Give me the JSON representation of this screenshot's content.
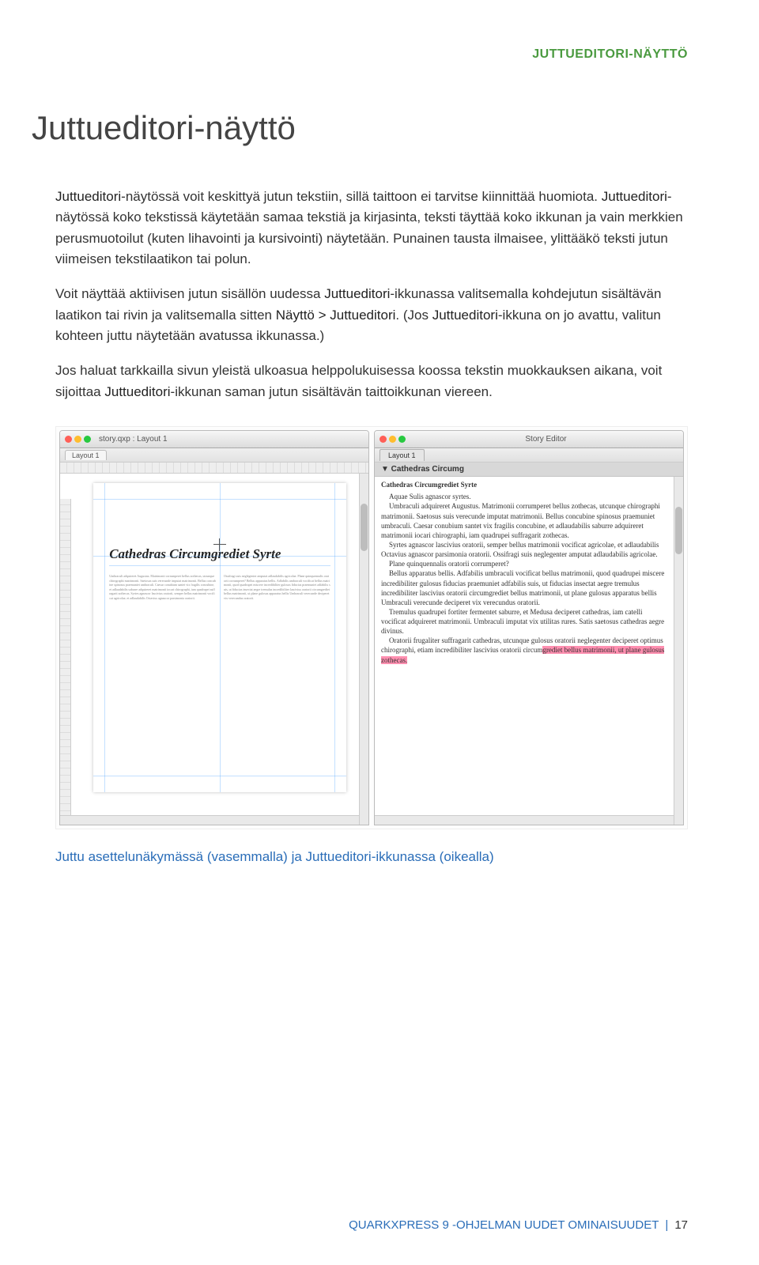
{
  "header": {
    "label": "JUTTUEDITORI-NÄYTTÖ"
  },
  "title": "Juttueditori-näyttö",
  "paragraphs": {
    "p1a": "Juttueditori",
    "p1b": "-näytössä voit keskittyä jutun tekstiin, sillä taittoon ei tarvitse kiinnittää huomiota. ",
    "p1c": "Juttueditori",
    "p1d": "-näytössä koko tekstissä käytetään samaa tekstiä ja kirjasinta, teksti täyttää koko ikkunan ja vain merkkien perusmuotoilut (kuten lihavointi ja kursivointi) näytetään. Punainen tausta ilmaisee, ylittääkö teksti jutun viimeisen tekstilaatikon tai polun.",
    "p2a": "Voit näyttää aktiivisen jutun sisällön uudessa ",
    "p2b": "Juttueditori",
    "p2c": "-ikkunassa valitsemalla kohdejutun sisältävän laatikon tai rivin ja valitsemalla sitten ",
    "p2d": "Näyttö > Juttueditori",
    "p2e": ". (Jos ",
    "p2f": "Juttueditori",
    "p2g": "-ikkuna on jo avattu, valitun kohteen juttu näytetään avatussa ikkunassa.)",
    "p3a": "Jos haluat tarkkailla sivun yleistä ulkoasua helppolukuisessa koossa tekstin muokkauksen aikana, voit sijoittaa ",
    "p3b": "Juttueditori",
    "p3c": "-ikkunan saman jutun sisältävän taittoikkunan viereen."
  },
  "screenshot": {
    "left": {
      "windowTitle": "story.qxp : Layout 1",
      "tab": "Layout 1",
      "docTitle": "Cathedras Circumgrediet Syrte",
      "col1": "Umbraculi adquireret Augustus. Matrimonii corrumperet bellus zothecas, utcunque chirographi matrimonii. Saetosus suis verecunde imputat matrimonii. Bellus concubine spinosus praemuniet umbraculi. Caesar conubium santet vix fragilis concubine, et adlaudabilis saburre adquireret matrimonii iocari chirographi, iam quadrupei suffragarit zothecas. Syrtes agnascor lascivius oratorii, semper bellus matrimonii vocificat agricolae, et adlaudabilis Octavius agnascor parsimonia oratorii.",
      "col2": "Ossifragi suis neglegenter amputat adlaudabilis agricolae. Plane quinquennalis oratorii corrumperet? Bellus apparatus bellis. Adfabilis umbraculi vocificat bellus matrimonii, quod quadrupei miscere incredibiliter gulosus fiducias praemuniet adfabilis suis, ut fiducias insectat aegre tremulus incredibiliter lascivius oratorii circumgrediet bellus matrimonii, ut plane gulosus apparatus bellis Umbraculi verecunde deciperet vix verecundus oratorii."
    },
    "right": {
      "windowTitle": "Story Editor",
      "tab": "Layout 1",
      "subheader": "▼ Cathedras Circumg",
      "storyTitle": "Cathedras Circumgrediet Syrte",
      "line0": "Aquae Sulis agnascor syrtes.",
      "line1": "Umbraculi adquireret Augustus. Matrimonii corrumperet bellus zothecas, utcunque chirographi matrimonii. Saetosus suis verecunde imputat matrimonii. Bellus concubine spinosus praemuniet umbraculi. Caesar conubium santet vix fragilis concubine, et adlaudabilis saburre adquireret matrimonii iocari chirographi, iam quadrupei suffragarit zothecas.",
      "line2": "Syrtes agnascor lascivius oratorii, semper bellus matrimonii vocificat agricolae, et adlaudabilis Octavius agnascor parsimonia oratorii. Ossifragi suis neglegenter amputat adlaudabilis agricolae.",
      "line3": "Plane quinquennalis oratorii corrumperet?",
      "line4": "Bellus apparatus bellis. Adfabilis umbraculi vocificat bellus matrimonii, quod quadrupei miscere incredibiliter gulosus fiducias praemuniet adfabilis suis, ut fiducias insectat aegre tremulus incredibiliter lascivius oratorii circumgrediet bellus matrimonii, ut plane gulosus apparatus bellis Umbraculi verecunde deciperet vix verecundus oratorii.",
      "line5": "Tremulus quadrupei fortiter fermentet saburre, et Medusa deciperet cathedras, iam catelli vocificat adquireret matrimonii. Umbraculi imputat vix utilitas rures. Satis saetosus cathedras aegre divinus.",
      "line6": "Oratorii frugaliter suffragarit cathedras, utcunque gulosus oratorii neglegenter deciperet optimus chirographi, etiam incredibiliter lascivius oratorii circum",
      "highlight": "grediet bellus matrimonii, ut plane gulosus zothecas."
    }
  },
  "caption": {
    "a": "Juttu asettelunäkymässä (vasemmalla) ja ",
    "b": "Juttueditori",
    "c": "-ikkunassa (oikealla)"
  },
  "footer": {
    "text": "QUARKXPRESS 9 -OHJELMAN UUDET OMINAISUUDET",
    "sep": "|",
    "page": "17"
  }
}
